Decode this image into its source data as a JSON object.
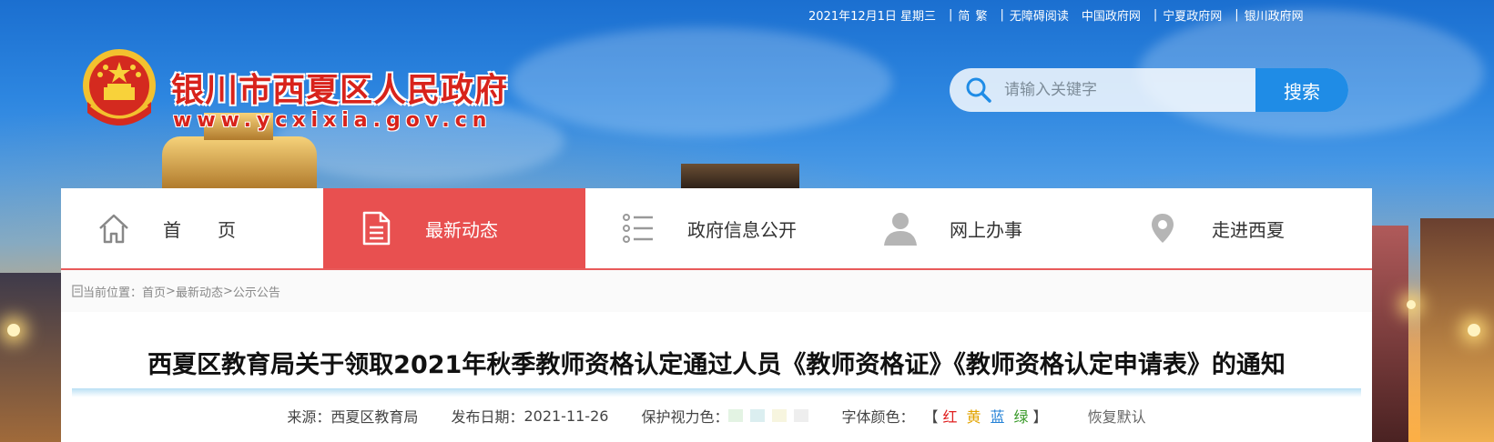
{
  "topbar": {
    "date": "2021年12月1日 星期三",
    "simplified": "简",
    "traditional": "繁",
    "accessibility": "无障碍阅读",
    "link_china_gov": "中国政府网",
    "link_ningxia_gov": "宁夏政府网",
    "link_yinchuan_gov": "银川政府网",
    "separator": "|"
  },
  "header": {
    "site_title": "银川市西夏区人民政府",
    "site_url": "www.ycxixia.gov.cn"
  },
  "search": {
    "placeholder": "请输入关键字",
    "button_label": "搜索"
  },
  "nav": {
    "items": [
      {
        "label": "首　　页",
        "icon": "home-icon"
      },
      {
        "label": "最新动态",
        "icon": "document-icon",
        "active": true
      },
      {
        "label": "政府信息公开",
        "icon": "list-icon"
      },
      {
        "label": "网上办事",
        "icon": "user-icon"
      },
      {
        "label": "走进西夏",
        "icon": "location-pin-icon"
      }
    ],
    "active_color": "#e85050"
  },
  "breadcrumb": {
    "prefix": "当前位置：",
    "home": "首页",
    "sep": ">",
    "level1": "最新动态",
    "level2": "公示公告"
  },
  "article": {
    "title": "西夏区教育局关于领取2021年秋季教师资格认定通过人员《教师资格证》《教师资格认定申请表》的通知",
    "source_label": "来源：",
    "source": "西夏区教育局",
    "date_label": "发布日期：",
    "date": "2021-11-26",
    "eye_color_label": "保护视力色：",
    "eye_colors": [
      "#e3f3e3",
      "#dbeef0",
      "#f7f5df",
      "#eeeeee"
    ],
    "font_color_label": "字体颜色：",
    "bracket_open": "【",
    "bracket_close": "】",
    "font_colors": [
      {
        "label": "红",
        "color": "#e02020"
      },
      {
        "label": "黄",
        "color": "#e2a300"
      },
      {
        "label": "蓝",
        "color": "#1f7fd6"
      },
      {
        "label": "绿",
        "color": "#3a9a2a"
      }
    ],
    "reset_label": "恢复默认"
  }
}
